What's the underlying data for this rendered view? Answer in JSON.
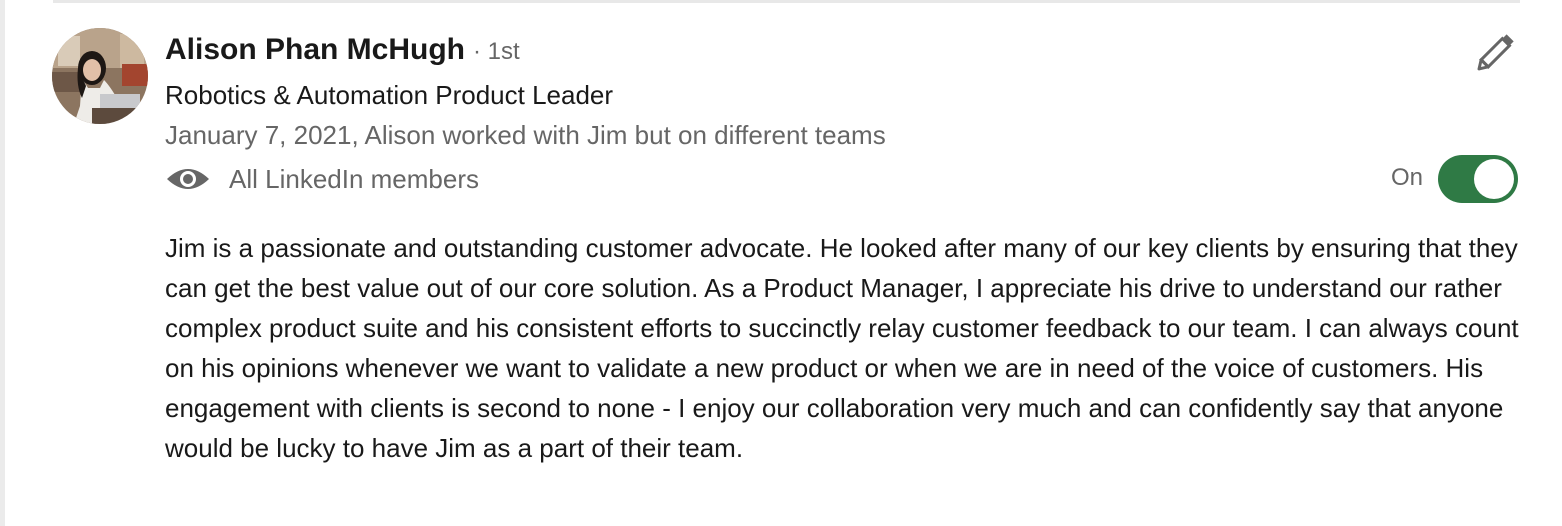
{
  "recommendation": {
    "author_name": "Alison Phan McHugh",
    "connection_degree": "· 1st",
    "headline": "Robotics & Automation Product Leader",
    "meta": "January 7, 2021, Alison worked with Jim but on different teams",
    "visibility_label": "All LinkedIn members",
    "toggle_state": "On",
    "toggle_on": true,
    "body": "Jim is a passionate and outstanding customer advocate. He looked after many of our key clients by ensuring that they can get the best value out of our core solution. As a Product Manager, I appreciate his drive to understand our rather complex product suite and his consistent efforts to succinctly relay customer feedback to our team. I can always count on his opinions whenever we want to validate a new product or when we are in need of the voice of customers. His engagement with clients is second to none - I enjoy our collaboration very much and can confidently say that anyone would be lucky to have Jim as a part of their team."
  },
  "icons": {
    "edit": "pencil-icon",
    "visibility": "eye-icon"
  },
  "colors": {
    "toggle_on": "#2f7a45",
    "text_primary": "#191919",
    "text_secondary": "#666666"
  }
}
